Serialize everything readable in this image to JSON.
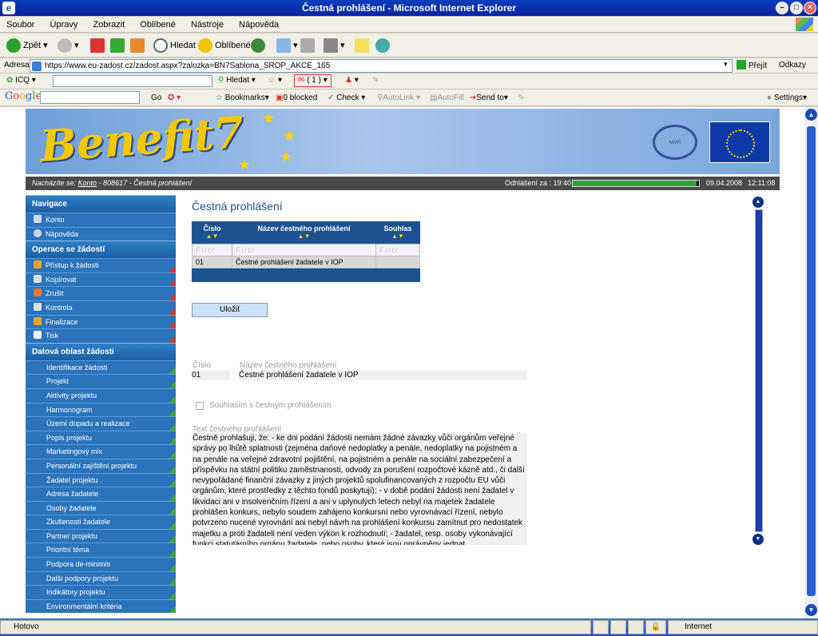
{
  "window": {
    "title": "Čestná prohlášení - Microsoft Internet Explorer"
  },
  "menu": [
    "Soubor",
    "Úpravy",
    "Zobrazit",
    "Oblíbené",
    "Nástroje",
    "Nápověda"
  ],
  "toolbar": {
    "back": "Zpět",
    "search": "Hledat",
    "favorites": "Oblíbené"
  },
  "address": {
    "label": "Adresa",
    "url": "https://www.eu-zadost.cz/zadost.aspx?zalozka=BN7Sablona_SROP_AKCE_165",
    "go": "Přejít",
    "links": "Odkazy"
  },
  "icqbar": {
    "icq": "ICQ",
    "search": "Hledat",
    "count": "( 1 )"
  },
  "googlebar": {
    "go": "Go",
    "bookmarks": "Bookmarks▾",
    "blocked": "0 blocked",
    "check": "Check ▾",
    "autolink": "AutoLink ▾",
    "autofill": "AutoFill",
    "sendto": "Send to▾",
    "settings": "Settings▾"
  },
  "banner": {
    "logo": "Benefit7"
  },
  "crumb": {
    "prefix": "Nacházíte se: ",
    "link": "Konto",
    "rest": " - 808617 - Čestná prohlášení",
    "logout": "Odhlášení za : 19:40",
    "date": "09.04.2008",
    "time": "12:11:08",
    "progress": 0.98
  },
  "sidebar": {
    "nav_title": "Navigace",
    "nav": [
      "Konto",
      "Nápověda"
    ],
    "ops_title": "Operace se žádostí",
    "ops": [
      "Přístup k žádosti",
      "Kopírovat",
      "Zrušit",
      "Kontrola",
      "Finalizace",
      "Tisk"
    ],
    "data_title": "Datová oblast žádosti",
    "data": [
      "Identifikace žádosti",
      "Projekt",
      "Aktivity projektu",
      "Harmonogram",
      "Území dopadu a realizace",
      "Popis projektu",
      "Marketingový mix",
      "Personální zajištění projektu",
      "Žadatel projektu",
      "Adresa žadatele",
      "Osoby žadatele",
      "Zkušenosti žadatele",
      "Partner projektu",
      "Prioritní téma",
      "Podpora de-minimis",
      "Další podpory projektu",
      "Indikátory projektu",
      "Environmentální kritéria"
    ]
  },
  "content": {
    "title": "Čestná prohlášení",
    "grid": {
      "headers": [
        "Číslo",
        "Název čestného prohlášení",
        "Souhlas"
      ],
      "filter": "Filtr",
      "rows": [
        [
          "01",
          "Čestné prohlášení žadatele v IOP",
          ""
        ]
      ]
    },
    "save": "Uložit",
    "detail": {
      "num_label": "Číslo",
      "num_value": "01",
      "name_label": "Název čestného prohlášení",
      "name_value": "Čestné prohlášení žadatele v IOP",
      "agree_label": "Souhlasím s čestným prohlášením",
      "text_label": "Text čestného prohlášení",
      "text": "Čestně prohlašuji, že: - ke dni podání žádosti nemám žádné závazky vůči orgánům veřejné správy po lhůtě splatnosti (zejména daňové nedoplatky a penále, nedoplatky na pojistném a na penále na veřejné zdravotní pojištění, na pojistném a penále na sociální zabezpečení a příspěvku na státní politiku zaměstnanosti, odvody za porušení rozpočtové kázně atd., či další nevypořádané finanční závazky z jiných projektů spolufinancovaných z rozpočtu EU vůči orgánům, které prostředky z těchto fondů poskytují); - v době podání žádosti není žadatel v likvidaci ani v insolvenčním řízení a ani v uplynulých letech nebyl na majetek žadatele prohlášen konkurs, nebylo soudem zahájeno konkursní nebo vyrovnávací řízení, nebylo potvrzeno nucené vyrovnání ani nebyl návrh na prohlášení konkursu zamítnut pro nedostatek majetku a proti žadateli není veden výkon k rozhodnutí; - žadatel, resp. osoby vykonávající funkci statutárního orgánu žadatele, nebo osoby, které jsou oprávněny jednat"
    }
  },
  "status": {
    "left": "Hotovo",
    "zone": "Internet"
  }
}
